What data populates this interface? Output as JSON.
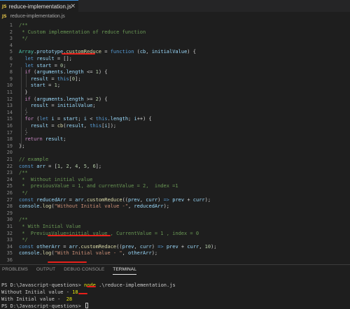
{
  "tab": {
    "icon": "JS",
    "label": "reduce-implementation.js",
    "close": "×"
  },
  "breadcrumb": {
    "icon": "JS",
    "label": "reduce-implementation.js"
  },
  "code_lines": [
    {
      "n": "1",
      "html": "<span class='c-cmt'>/**</span>"
    },
    {
      "n": "2",
      "html": "<span class='c-cmt'> * Custom implementation of reduce function</span>"
    },
    {
      "n": "3",
      "html": "<span class='c-cmt'> */</span>"
    },
    {
      "n": "4",
      "html": ""
    },
    {
      "n": "5",
      "html": "<span class='c-cls'>Array</span>.<span class='c-var'>prototype</span>.<span class='c-fn'>customReduce</span> = <span class='c-kw'>function</span> (<span class='c-var'>cb</span>, <span class='c-var'>initialValue</span>) {"
    },
    {
      "n": "6",
      "html": "  <span class='c-kw'>let</span> <span class='c-var'>result</span> = [];"
    },
    {
      "n": "7",
      "html": "  <span class='c-kw'>let</span> <span class='c-var'>start</span> = <span class='c-num'>0</span>;"
    },
    {
      "n": "8",
      "html": "  <span class='c-ctl'>if</span> (<span class='c-var'>arguments</span>.<span class='c-var'>length</span> &lt;= <span class='c-num'>1</span>) {"
    },
    {
      "n": "9",
      "html": "    <span class='c-var'>result</span> = <span class='c-kw'>this</span>[<span class='c-num'>0</span>];"
    },
    {
      "n": "10",
      "html": "    <span class='c-var'>start</span> = <span class='c-num'>1</span>;"
    },
    {
      "n": "11",
      "html": "  }"
    },
    {
      "n": "12",
      "html": "  <span class='c-ctl'>if</span> (<span class='c-var'>arguments</span>.<span class='c-var'>length</span> &gt;= <span class='c-num'>2</span>) {"
    },
    {
      "n": "13",
      "html": "    <span class='c-var'>result</span> = <span class='c-var'>initialValue</span>;"
    },
    {
      "n": "14",
      "html": "  }"
    },
    {
      "n": "15",
      "html": "  <span class='c-ctl'>for</span> (<span class='c-kw'>let</span> <span class='c-var'>i</span> = <span class='c-var'>start</span>; <span class='c-var'>i</span> &lt; <span class='c-kw'>this</span>.<span class='c-var'>length</span>; <span class='c-var'>i</span>++) {"
    },
    {
      "n": "16",
      "html": "    <span class='c-var'>result</span> = <span class='c-fn'>cb</span>(<span class='c-var'>result</span>, <span class='c-kw'>this</span>[<span class='c-var'>i</span>]);"
    },
    {
      "n": "17",
      "html": "  }"
    },
    {
      "n": "18",
      "html": "  <span class='c-ctl'>return</span> <span class='c-var'>result</span>;"
    },
    {
      "n": "19",
      "html": "};"
    },
    {
      "n": "20",
      "html": ""
    },
    {
      "n": "21",
      "html": "<span class='c-cmt'>// example</span>"
    },
    {
      "n": "22",
      "html": "<span class='c-kw'>const</span> <span class='c-var'>arr</span> = [<span class='c-num'>1</span>, <span class='c-num'>2</span>, <span class='c-num'>4</span>, <span class='c-num'>5</span>, <span class='c-num'>6</span>];"
    },
    {
      "n": "23",
      "html": "<span class='c-cmt'>/**</span>"
    },
    {
      "n": "24",
      "html": "<span class='c-cmt'> *  Without initial value</span>"
    },
    {
      "n": "25",
      "html": "<span class='c-cmt'> *  previousValue = 1, and currentValue = 2,  index =1</span>"
    },
    {
      "n": "26",
      "html": "<span class='c-cmt'> */</span>"
    },
    {
      "n": "27",
      "html": "<span class='c-kw'>const</span> <span class='c-var'>reducedArr</span> = <span class='c-var'>arr</span>.<span class='c-fn'>customReduce</span>((<span class='c-var'>prev</span>, <span class='c-var'>curr</span>) <span class='c-kw'>=&gt;</span> <span class='c-var'>prev</span> + <span class='c-var'>curr</span>);"
    },
    {
      "n": "28",
      "html": "<span class='c-var'>console</span>.<span class='c-fn'>log</span>(<span class='c-str'>\"Without Initial value -\"</span>, <span class='c-var'>reducedArr</span>);"
    },
    {
      "n": "29",
      "html": ""
    },
    {
      "n": "30",
      "html": "<span class='c-cmt'>/**</span>"
    },
    {
      "n": "31",
      "html": "<span class='c-cmt'> * With Initial Value</span>"
    },
    {
      "n": "32",
      "html": "<span class='c-cmt'> *  PreviusValue=initial value , CurrentValue = 1 , index = 0</span>"
    },
    {
      "n": "33",
      "html": "<span class='c-cmt'> */</span>"
    },
    {
      "n": "34",
      "html": "<span class='c-kw'>const</span> <span class='c-var'>otherArr</span> = <span class='c-var'>arr</span>.<span class='c-fn'>customRedace</span>((<span class='c-var'>prev</span>, <span class='c-var'>curr</span>) <span class='c-kw'>=&gt;</span> <span class='c-var'>prev</span> + <span class='c-var'>curr</span>, <span class='c-num'>10</span>);"
    },
    {
      "n": "35",
      "html": "<span class='c-var'>console</span>.<span class='c-fn'>log</span>(<span class='c-str'>\"With Initial value - \"</span>, <span class='c-var'>otherArr</span>);"
    },
    {
      "n": "36",
      "html": ""
    }
  ],
  "panel_tabs": [
    {
      "label": "PROBLEMS",
      "active": false
    },
    {
      "label": "OUTPUT",
      "active": false
    },
    {
      "label": "DEBUG CONSOLE",
      "active": false
    },
    {
      "label": "TERMINAL",
      "active": true
    }
  ],
  "terminal": {
    "line1_prompt": "PS D:\\Javascript-questions> ",
    "line1_cmd": "node",
    "line1_arg": " .\\reduce-implementation.js",
    "line2_label": "Without Initial value - ",
    "line2_value": "18",
    "line3_label": "With Initial value -  ",
    "line3_value": "28",
    "line4_prompt": "PS D:\\Javascript-questions> "
  },
  "colors": {
    "background": "#1e1e1e",
    "annotation_underline": "#e8201a",
    "terminal_command": "#e5e510"
  }
}
